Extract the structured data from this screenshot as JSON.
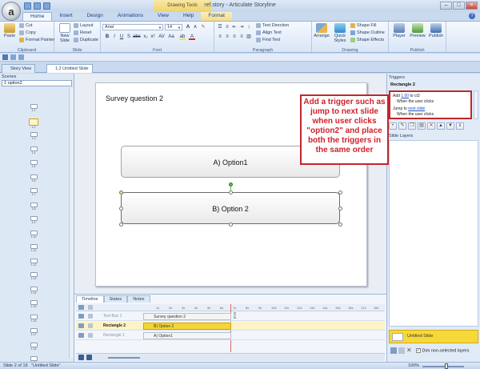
{
  "window": {
    "title": "ref.story - Articulate Storyline",
    "context_tab": "Drawing Tools"
  },
  "tabs": [
    "Home",
    "Insert",
    "Design",
    "Animations",
    "View",
    "Help",
    "Format"
  ],
  "ribbon": {
    "clipboard": {
      "paste": "Paste",
      "cut": "Cut",
      "copy": "Copy",
      "format_painter": "Format Painter",
      "label": "Clipboard"
    },
    "slide": {
      "new_slide": "New Slide",
      "layout": "Layout",
      "reset": "Reset",
      "duplicate": "Duplicate",
      "label": "Slide"
    },
    "font": {
      "family": "Arial",
      "size": "14",
      "label": "Font"
    },
    "paragraph": {
      "text_direction": "Text Direction",
      "align_text": "Align Text",
      "find_text": "Find Text",
      "label": "Paragraph"
    },
    "drawing": {
      "arrange": "Arrange",
      "quick_styles": "Quick Styles",
      "shape_fill": "Shape Fill",
      "shape_outline": "Shape Outline",
      "shape_effects": "Shape Effects",
      "label": "Drawing"
    },
    "publish": {
      "player": "Player",
      "preview": "Preview",
      "publish": "Publish",
      "label": "Publish"
    }
  },
  "doc_tabs": {
    "story_view": "Story View",
    "active": "1.2 Untitled Slide"
  },
  "scenes": {
    "title": "Scenes",
    "selected": "1 option2",
    "thumbnails": [
      "1.1",
      "1.2",
      "1.3",
      "1.4",
      "1.5",
      "1.6",
      "1.7",
      "1.8",
      "1.9",
      "1.10",
      "1.11",
      "1.12",
      "1.13",
      "1.14",
      "1.15",
      "1.16",
      "1.17",
      "1.18",
      "1.19"
    ]
  },
  "slide": {
    "title": "Survey question 2",
    "option1": "A) Option1",
    "option2": "B) Option 2"
  },
  "annotation": "Add a trigger such as jump to next slide when user clicks \"option2\" and place both the triggers in the same order",
  "triggers": {
    "title": "Triggers",
    "object": "Rectangle 2",
    "t1_action": "Add",
    "t1_value": "1.00",
    "t1_target": "to ct3",
    "t1_when": "When the user clicks",
    "t2_action": "Jump to",
    "t2_target": "next slide",
    "t2_when": "When the user clicks"
  },
  "layers": {
    "title": "Slide Layers",
    "base_layer": "Untitled Slide",
    "dim_label": "Dim non-selected layers"
  },
  "timeline": {
    "tabs": [
      "Timeline",
      "States",
      "Notes"
    ],
    "end_label": "End",
    "rows": [
      {
        "name": "Text Box 1",
        "bar": "Survey question 2",
        "selected": false
      },
      {
        "name": "Rectangle 2",
        "bar": "B) Option 2",
        "selected": true
      },
      {
        "name": "Rectangle 1",
        "bar": "A) Option1",
        "selected": false
      }
    ],
    "ticks": [
      "1s",
      "2s",
      "3s",
      "4s",
      "5s",
      "6s",
      "7s",
      "8s",
      "9s",
      "10s",
      "11s",
      "12s",
      "13s",
      "14s",
      "15s",
      "16s",
      "17s",
      "18s"
    ]
  },
  "status": {
    "slide_info": "Slide 2 of 19",
    "slide_name": "\"Untitled Slide\"",
    "zoom": "100%"
  },
  "colors": {
    "accent": "#f5d53a",
    "annotation": "#d0202a"
  }
}
